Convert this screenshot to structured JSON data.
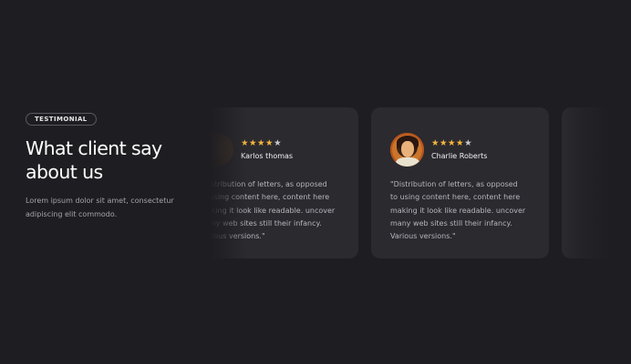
{
  "section": {
    "badge": "TESTIMONIAL",
    "heading": "What client say about us",
    "text": "Lorem ipsum dolor sit amet, consectetur adipiscing elit commodo."
  },
  "testimonials": [
    {
      "name": "Karlos thomas",
      "rating": 4,
      "stars_filled": "★★★★",
      "stars_empty": "★",
      "quote": "\"Distribution of letters, as opposed to using content here, content here making it look like readable. uncover many web sites still their infancy. Various versions.\""
    },
    {
      "name": "Charlie Roberts",
      "rating": 4,
      "stars_filled": "★★★★",
      "stars_empty": "★",
      "quote": "\"Distribution of letters, as opposed to using content here, content here making it look like readable. uncover many web sites still their infancy. Various versions.\""
    }
  ],
  "colors": {
    "background": "#1e1d21",
    "card": "#2b2a2f",
    "star": "#f6b63b",
    "muted_text": "#a5a4ab"
  }
}
